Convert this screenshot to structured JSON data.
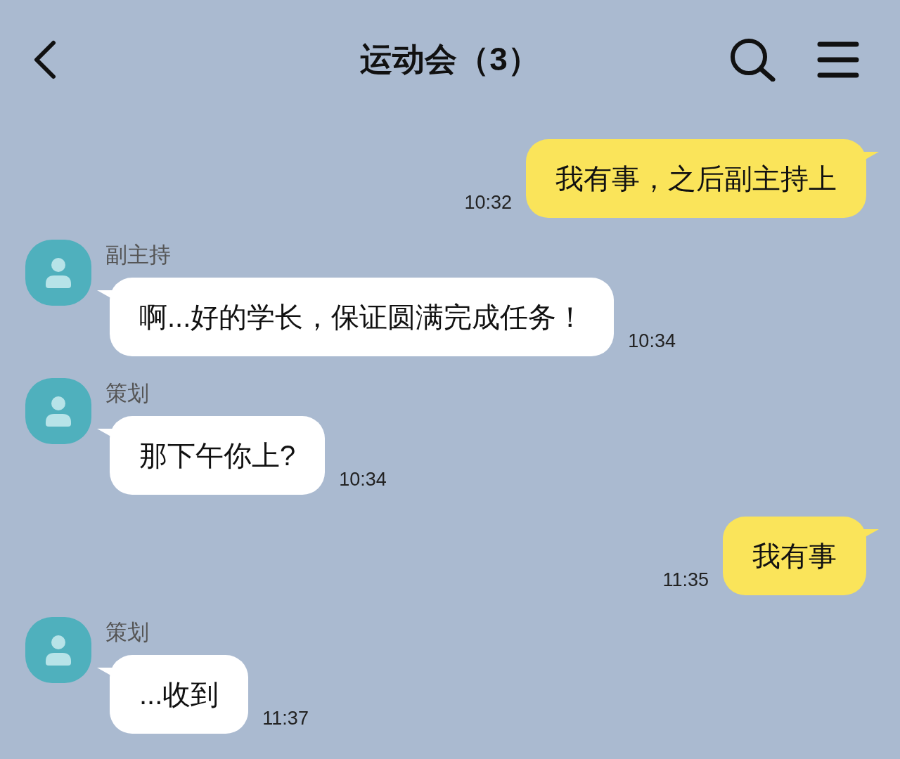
{
  "header": {
    "title": "运动会（3）"
  },
  "messages": [
    {
      "kind": "outgoing",
      "text": "我有事，之后副主持上",
      "time": "10:32"
    },
    {
      "kind": "incoming",
      "sender": "副主持",
      "text": "啊...好的学长，保证圆满完成任务！",
      "time": "10:34"
    },
    {
      "kind": "incoming",
      "sender": "策划",
      "text": "那下午你上?",
      "time": "10:34"
    },
    {
      "kind": "outgoing",
      "text": "我有事",
      "time": "11:35"
    },
    {
      "kind": "incoming",
      "sender": "策划",
      "text": "...收到",
      "time": "11:37"
    }
  ]
}
